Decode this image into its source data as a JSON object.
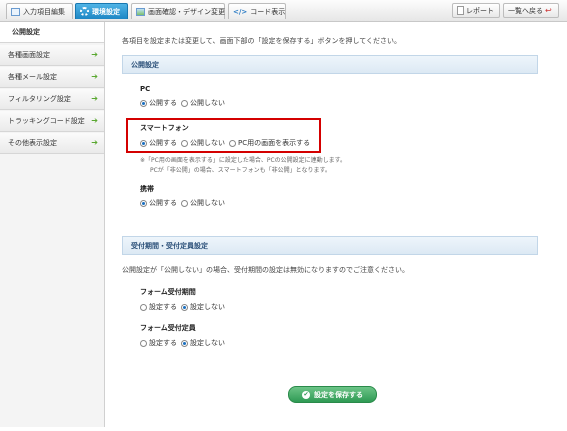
{
  "tabs": [
    {
      "label": "入力項目編集",
      "icon": "document-icon"
    },
    {
      "label": "環境設定",
      "icon": "gear-icon",
      "active": true
    },
    {
      "label": "画面確認・デザイン変更",
      "icon": "picture-icon"
    },
    {
      "label": "コード表示",
      "icon": "code-icon"
    }
  ],
  "header_buttons": {
    "report": "レポート",
    "back": "一覧へ戻る"
  },
  "sidebar": [
    {
      "label": "公開設定",
      "active": true
    },
    {
      "label": "各種画面設定"
    },
    {
      "label": "各種メール設定"
    },
    {
      "label": "フィルタリング設定"
    },
    {
      "label": "トラッキングコード設定"
    },
    {
      "label": "その他表示設定"
    }
  ],
  "intro": "各項目を設定または変更して、画面下部の「設定を保存する」ボタンを押してください。",
  "publish": {
    "heading": "公開設定",
    "pc": {
      "label": "PC",
      "options": [
        "公開する",
        "公開しない"
      ],
      "selected": 0
    },
    "smartphone": {
      "label": "スマートフォン",
      "options": [
        "公開する",
        "公開しない",
        "PC用の画面を表示する"
      ],
      "selected": 0
    },
    "note_line1": "※「PC用の画面を表示する」に設定した場合、PCの公開設定に連動します。",
    "note_line2": "PCが「非公開」の場合、スマートフォンも「非公開」となります。",
    "mobile": {
      "label": "携帯",
      "options": [
        "公開する",
        "公開しない"
      ],
      "selected": 0
    }
  },
  "period": {
    "heading": "受付期間・受付定員設定",
    "note": "公開設定が「公開しない」の場合、受付期間の設定は無効になりますのでご注意ください。",
    "form_period": {
      "label": "フォーム受付期間",
      "options": [
        "設定する",
        "設定しない"
      ],
      "selected": 1
    },
    "form_capacity": {
      "label": "フォーム受付定員",
      "options": [
        "設定する",
        "設定しない"
      ],
      "selected": 1
    }
  },
  "save_button": "設定を保存する",
  "colors": {
    "active_tab": "#1d86c4",
    "highlight": "#d40000",
    "save": "#2f9a54"
  }
}
